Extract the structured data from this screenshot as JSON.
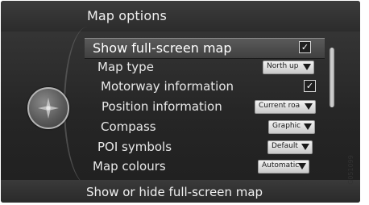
{
  "header": {
    "title": "Map options"
  },
  "footer": {
    "hint": "Show or hide full-screen map"
  },
  "menu": {
    "items": [
      {
        "label": "Show full-screen map",
        "control": "checkbox",
        "checked": true,
        "selected": true
      },
      {
        "label": "Map type",
        "control": "dropdown",
        "value": "North up"
      },
      {
        "label": "Motorway information",
        "control": "checkbox",
        "checked": true
      },
      {
        "label": "Position information",
        "control": "dropdown",
        "value": "Current roa"
      },
      {
        "label": "Compass",
        "control": "dropdown",
        "value": "Graphic"
      },
      {
        "label": "POI symbols",
        "control": "dropdown",
        "value": "Default"
      },
      {
        "label": "Map colours",
        "control": "dropdown",
        "value": "Automatic"
      }
    ]
  },
  "image_code": "G051099",
  "icons": {
    "checkmark": "✓",
    "knob": "compass-knob-icon"
  },
  "colors": {
    "background": "#2a2a2a",
    "text": "#e8e8e8",
    "dropdown": "#e0e0e0"
  }
}
